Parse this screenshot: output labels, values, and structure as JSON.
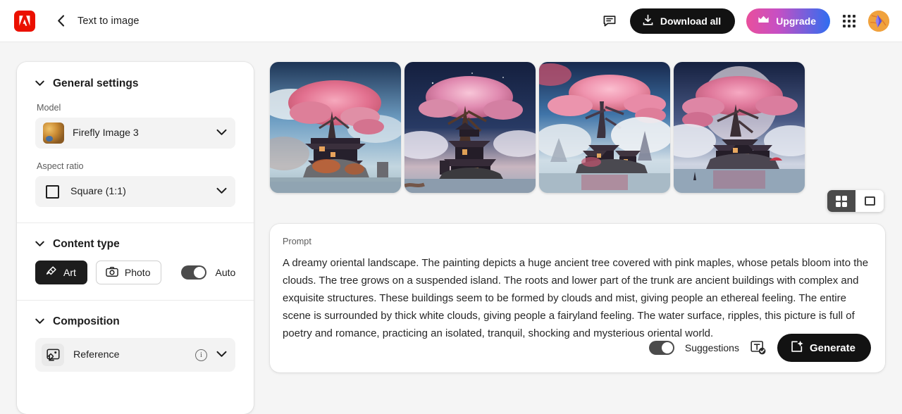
{
  "header": {
    "logo_icon": "adobe-logo",
    "back_icon": "chevron-left-icon",
    "title": "Text to image",
    "feedback_icon": "feedback-chat-icon",
    "download_all_label": "Download all",
    "download_icon": "download-icon",
    "upgrade_label": "Upgrade",
    "crown_icon": "crown-icon",
    "apps_icon": "apps-grid-icon",
    "avatar_icon": "user-avatar"
  },
  "sidebar": {
    "general_settings": {
      "title": "General settings",
      "chevron_icon": "chevron-down-icon",
      "model_label": "Model",
      "model_value": "Firefly Image 3",
      "model_chevron_icon": "chevron-down-icon",
      "aspect_label": "Aspect ratio",
      "aspect_value": "Square (1:1)",
      "aspect_icon": "square-icon",
      "aspect_chevron_icon": "chevron-down-icon"
    },
    "content_type": {
      "title": "Content type",
      "chevron_icon": "chevron-down-icon",
      "art_label": "Art",
      "art_icon": "paintbrush-icon",
      "photo_label": "Photo",
      "photo_icon": "camera-icon",
      "auto_label": "Auto",
      "auto_toggle_state": "on"
    },
    "composition": {
      "title": "Composition",
      "chevron_icon": "chevron-down-icon",
      "reference_label": "Reference",
      "reference_icon": "image-reference-icon",
      "info_icon": "info-icon",
      "chevron_row_icon": "chevron-down-icon"
    }
  },
  "results": {
    "images": [
      {
        "alt": "Pink maple tree over pagoda island, daytime blue sky"
      },
      {
        "alt": "Ancient tree with pagoda on island, dusk purple sky"
      },
      {
        "alt": "Twisting pink blossom tree above pagoda, white clouds"
      },
      {
        "alt": "Blossom tree with moon backdrop over misty water"
      }
    ],
    "view_toggle": {
      "grid_icon": "grid-view-icon",
      "grid_selected": true,
      "single_icon": "single-view-icon",
      "single_selected": false
    }
  },
  "prompt": {
    "caption": "Prompt",
    "text": "A dreamy oriental landscape. The painting depicts a huge ancient tree covered with pink maples, whose petals bloom into the clouds. The tree grows on a suspended island. The roots and lower part of the trunk are ancient buildings with complex and exquisite structures. These buildings seem to be formed by clouds and mist, giving people an ethereal feeling. The entire scene is surrounded by thick white clouds, giving people a fairyland feeling. The water surface, ripples, this picture is full of poetry and romance, practicing an isolated, tranquil, shocking and mysterious oriental world.",
    "suggestions_label": "Suggestions",
    "suggestions_toggle_state": "on",
    "text_check_icon": "text-check-icon",
    "generate_label": "Generate",
    "generate_icon": "generate-sparkle-icon"
  },
  "colors": {
    "accent_red": "#eb1000",
    "dark": "#121212",
    "upgrade_gradient_start": "#e94f9c",
    "upgrade_gradient_end": "#2f6ef0",
    "page_bg": "#f5f5f5"
  }
}
